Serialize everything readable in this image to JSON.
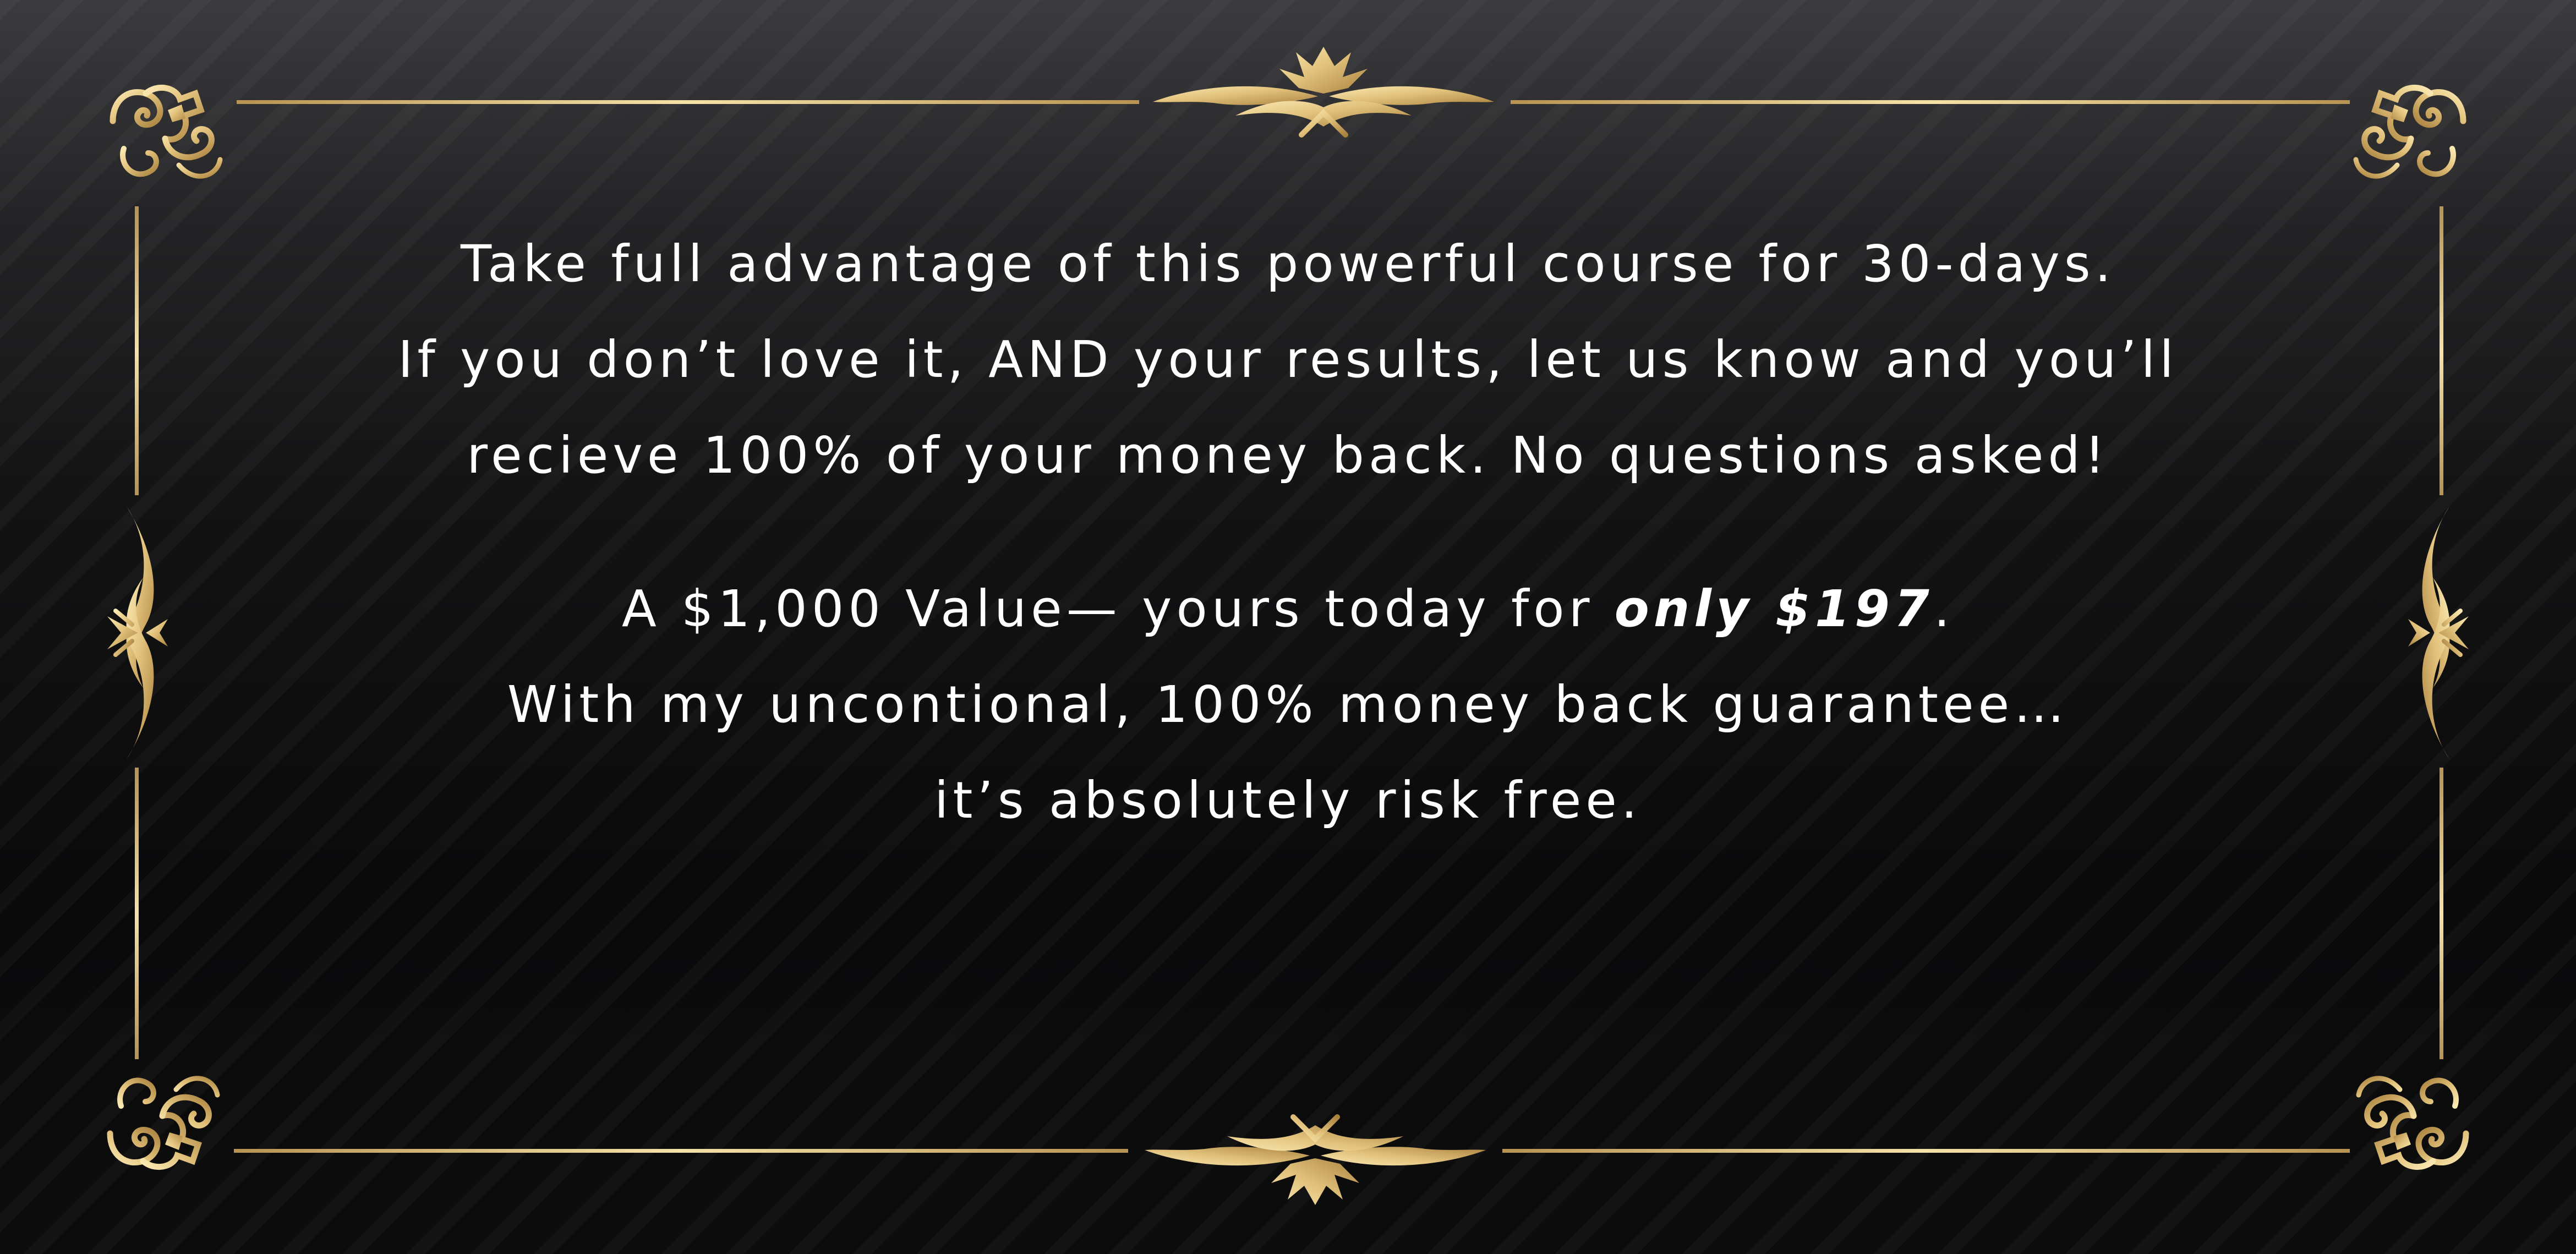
{
  "guarantee": {
    "line1": "Take full advantage of this powerful course for 30-days.",
    "line2": "If you don’t love it, AND your results, let us know and you’ll",
    "line3": "recieve 100% of your money back. No questions asked!"
  },
  "offer": {
    "line1_prefix": "A $1,000 Value— yours today for ",
    "line1_emphasis": "only $197",
    "line1_suffix": ".",
    "line2": "With my uncontional, 100% money back guarantee…",
    "line3": "it’s absolutely risk free."
  },
  "colors": {
    "gold_light": "#f6e3a6",
    "gold_dark": "#b8924c",
    "text": "#ffffff",
    "background": "#0b0b0c"
  },
  "ornaments": [
    "corner-flourish-icon",
    "center-flourish-icon",
    "side-flourish-icon"
  ]
}
